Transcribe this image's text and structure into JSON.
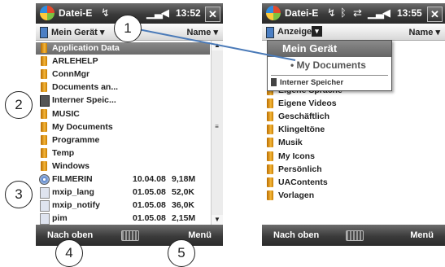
{
  "screen1": {
    "title": "Datei-E",
    "time": "13:52",
    "close": "✕",
    "header_left": "Mein Gerät",
    "header_right": "Name",
    "header_left_arrow": "▾",
    "header_right_arrow": "▾",
    "items": [
      {
        "name": "Application Data",
        "date": "",
        "size": "",
        "icon": "folder",
        "selected": true
      },
      {
        "name": "ARLEHELP",
        "date": "",
        "size": "",
        "icon": "folder"
      },
      {
        "name": "ConnMgr",
        "date": "",
        "size": "",
        "icon": "folder"
      },
      {
        "name": "Documents an...",
        "date": "",
        "size": "",
        "icon": "folder"
      },
      {
        "name": "Interner Speic...",
        "date": "",
        "size": "",
        "icon": "drive"
      },
      {
        "name": "MUSIC",
        "date": "",
        "size": "",
        "icon": "folder"
      },
      {
        "name": "My Documents",
        "date": "",
        "size": "",
        "icon": "folder"
      },
      {
        "name": "Programme",
        "date": "",
        "size": "",
        "icon": "folder"
      },
      {
        "name": "Temp",
        "date": "",
        "size": "",
        "icon": "folder"
      },
      {
        "name": "Windows",
        "date": "",
        "size": "",
        "icon": "folder"
      },
      {
        "name": "FILMERIN",
        "date": "10.04.08",
        "size": "9,18M",
        "icon": "cd"
      },
      {
        "name": "mxip_lang",
        "date": "01.05.08",
        "size": "52,0K",
        "icon": "file"
      },
      {
        "name": "mxip_notify",
        "date": "01.05.08",
        "size": "36,0K",
        "icon": "file"
      },
      {
        "name": "pim",
        "date": "01.05.08",
        "size": "2,15M",
        "icon": "file"
      }
    ],
    "softkey_left": "Nach oben",
    "softkey_right": "Menü"
  },
  "screen2": {
    "title": "Datei-E",
    "time": "13:55",
    "close": "✕",
    "header_left": "Anzeigen",
    "header_right": "Name",
    "header_left_arrow": "▾",
    "header_right_arrow": "▾",
    "dropdown": {
      "item1": "Mein Gerät",
      "item2": "• My Documents",
      "item3": "Interner Speicher"
    },
    "items": [
      {
        "name": "Eigene Sprache",
        "icon": "folder"
      },
      {
        "name": "Eigene Videos",
        "icon": "folder"
      },
      {
        "name": "Geschäftlich",
        "icon": "folder"
      },
      {
        "name": "Klingeltöne",
        "icon": "folder"
      },
      {
        "name": "Musik",
        "icon": "folder"
      },
      {
        "name": "My Icons",
        "icon": "folder"
      },
      {
        "name": "Persönlich",
        "icon": "folder"
      },
      {
        "name": "UAContents",
        "icon": "folder"
      },
      {
        "name": "Vorlagen",
        "icon": "folder"
      }
    ],
    "softkey_left": "Nach oben",
    "softkey_right": "Menü"
  },
  "callouts": [
    "1",
    "2",
    "3",
    "4",
    "5"
  ],
  "icons": {
    "start": "windows-flag-icon",
    "status": [
      "connectivity-icon",
      "bluetooth-icon",
      "sync-icon",
      "signal-icon",
      "volume-icon"
    ]
  },
  "colors": {
    "titlebar": "#3a3a3a",
    "selection": "#7a7a7a",
    "callout_line": "#4a7ab8"
  }
}
